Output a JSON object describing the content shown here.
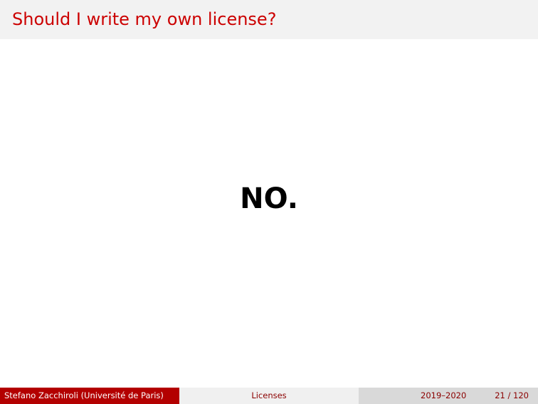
{
  "slide": {
    "title": "Should I write my own license?",
    "answer": "NO."
  },
  "footer": {
    "author": "Stefano Zacchiroli  (Université de Paris)",
    "topic": "Licenses",
    "date": "2019–2020",
    "page": "21 / 120"
  },
  "colors": {
    "title": "#cc0000",
    "footer_left_bg": "#b30000",
    "footer_text": "#8b0000"
  }
}
